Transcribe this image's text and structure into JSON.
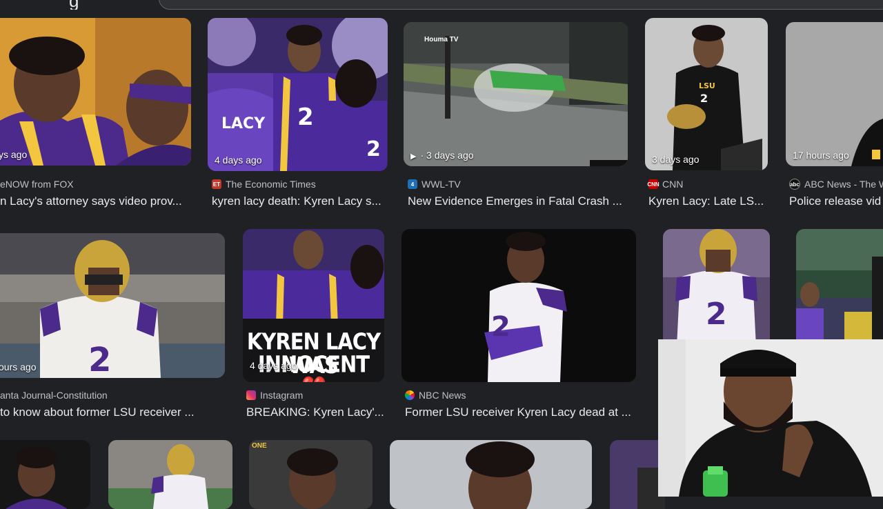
{
  "header": {
    "heading_fragment": "g"
  },
  "rows": [
    [
      {
        "time": "ys ago",
        "source": "eNOW from FOX",
        "title": "n Lacy's attorney says video prov...",
        "icon": "fox-icon"
      },
      {
        "time": "4 days ago",
        "source": "The Economic Times",
        "title": "kyren lacy death: Kyren Lacy s...",
        "icon": "et-icon",
        "icon_label": "ET"
      },
      {
        "time": "· 3 days ago",
        "source": "WWL-TV",
        "title": "New Evidence Emerges in Fatal Crash ...",
        "icon": "wwl-icon",
        "overlay_text": "Houma TV",
        "has_play": true
      },
      {
        "time": "3 days ago",
        "source": "CNN",
        "title": "Kyren Lacy: Late LS...",
        "icon": "cnn-icon",
        "icon_label": "CNN"
      },
      {
        "time": "17 hours ago",
        "source": "ABC News - The W",
        "title": "Police release vid",
        "icon": "abc-icon",
        "icon_label": "abc"
      }
    ],
    [
      {
        "time": "ours ago",
        "source": "anta Journal-Constitution",
        "title": " to know about former LSU receiver ...",
        "icon": "ajc-icon"
      },
      {
        "time": "4 days ago",
        "source": "Instagram",
        "title": "BREAKING: Kyren Lacy'...",
        "icon": "instagram-icon",
        "banner_line1": "KYREN LACY WAS",
        "banner_line2": "INNOCENT",
        "heart": "💔"
      },
      {
        "time": "",
        "source": "NBC News",
        "title": "Former LSU receiver Kyren Lacy dead at ...",
        "icon": "nbc-icon"
      },
      {
        "time": "",
        "source": "",
        "title": "",
        "icon": ""
      },
      {
        "time": "",
        "source": "",
        "title": "",
        "icon": ""
      }
    ],
    [
      {
        "overlay_text": ""
      },
      {
        "overlay_text": ""
      },
      {
        "overlay_text": "ONE"
      },
      {
        "overlay_text": ""
      },
      {
        "overlay_text": ""
      }
    ]
  ],
  "colors": {
    "background": "#202124",
    "lsu_purple": "#4b2a8c",
    "lsu_gold": "#f3c63f",
    "text_primary": "#e8eaed",
    "text_secondary": "#bdc1c6"
  }
}
